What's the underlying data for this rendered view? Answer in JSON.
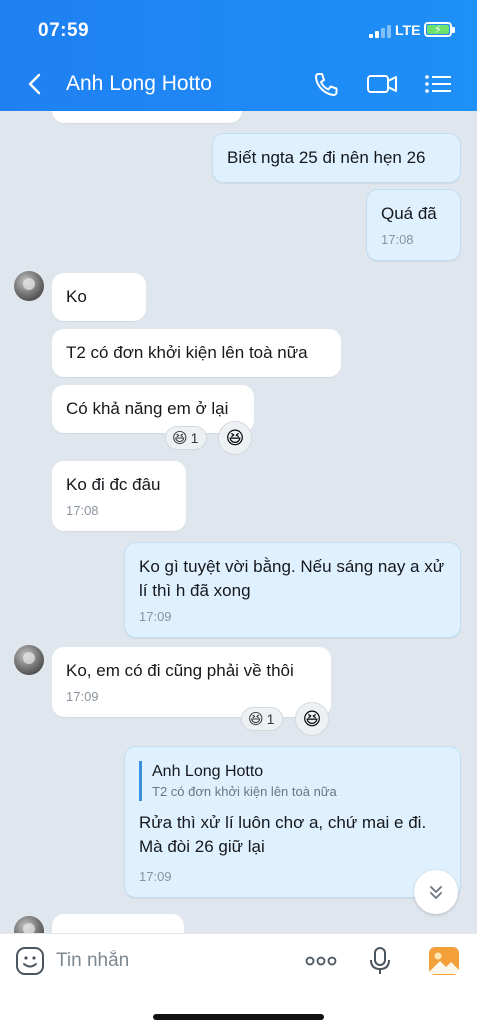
{
  "status": {
    "time": "07:59",
    "network": "LTE"
  },
  "header": {
    "title": "Anh Long Hotto"
  },
  "messages": {
    "m1": {
      "text": "Biết ngta 25 đi nên hẹn 26"
    },
    "m2": {
      "text": "Quá đã",
      "time": "17:08"
    },
    "m3": {
      "text": "Ko"
    },
    "m4": {
      "text": "T2 có đơn khởi kiện lên toà nữa"
    },
    "m5": {
      "text": "Có khả năng em ở lại",
      "reaction_count": "1"
    },
    "m6": {
      "text": "Ko đi đc đâu",
      "time": "17:08"
    },
    "m7": {
      "text": "Ko gì tuyệt vời bằng. Nếu sáng nay a xử lí thì h đã xong",
      "time": "17:09"
    },
    "m8": {
      "text": "Ko, em có đi cũng phải về thôi",
      "time": "17:09",
      "reaction_count": "1"
    },
    "m9": {
      "quote_name": "Anh Long Hotto",
      "quote_text": "T2 có đơn khởi kiện lên toà nữa",
      "text": "Rửa thì xử lí luôn chơ a, chứ mai e đi. Mà đòi 26 giữ lại",
      "time": "17:09"
    }
  },
  "composer": {
    "placeholder": "Tin nhắn"
  },
  "colors": {
    "header": "#1e88f5",
    "chat_bg": "#e0e6ee",
    "out_bubble": "#dff1ff",
    "in_bubble": "#ffffff"
  },
  "icons": {
    "back": "back-arrow-icon",
    "call": "phone-icon",
    "video": "video-camera-icon",
    "menu": "list-menu-icon",
    "sticker": "sticker-icon",
    "more": "more-dots-icon",
    "mic": "microphone-icon",
    "gallery": "image-gallery-icon",
    "scroll": "chevron-double-down-icon",
    "reaction": "laughing-face-icon"
  }
}
